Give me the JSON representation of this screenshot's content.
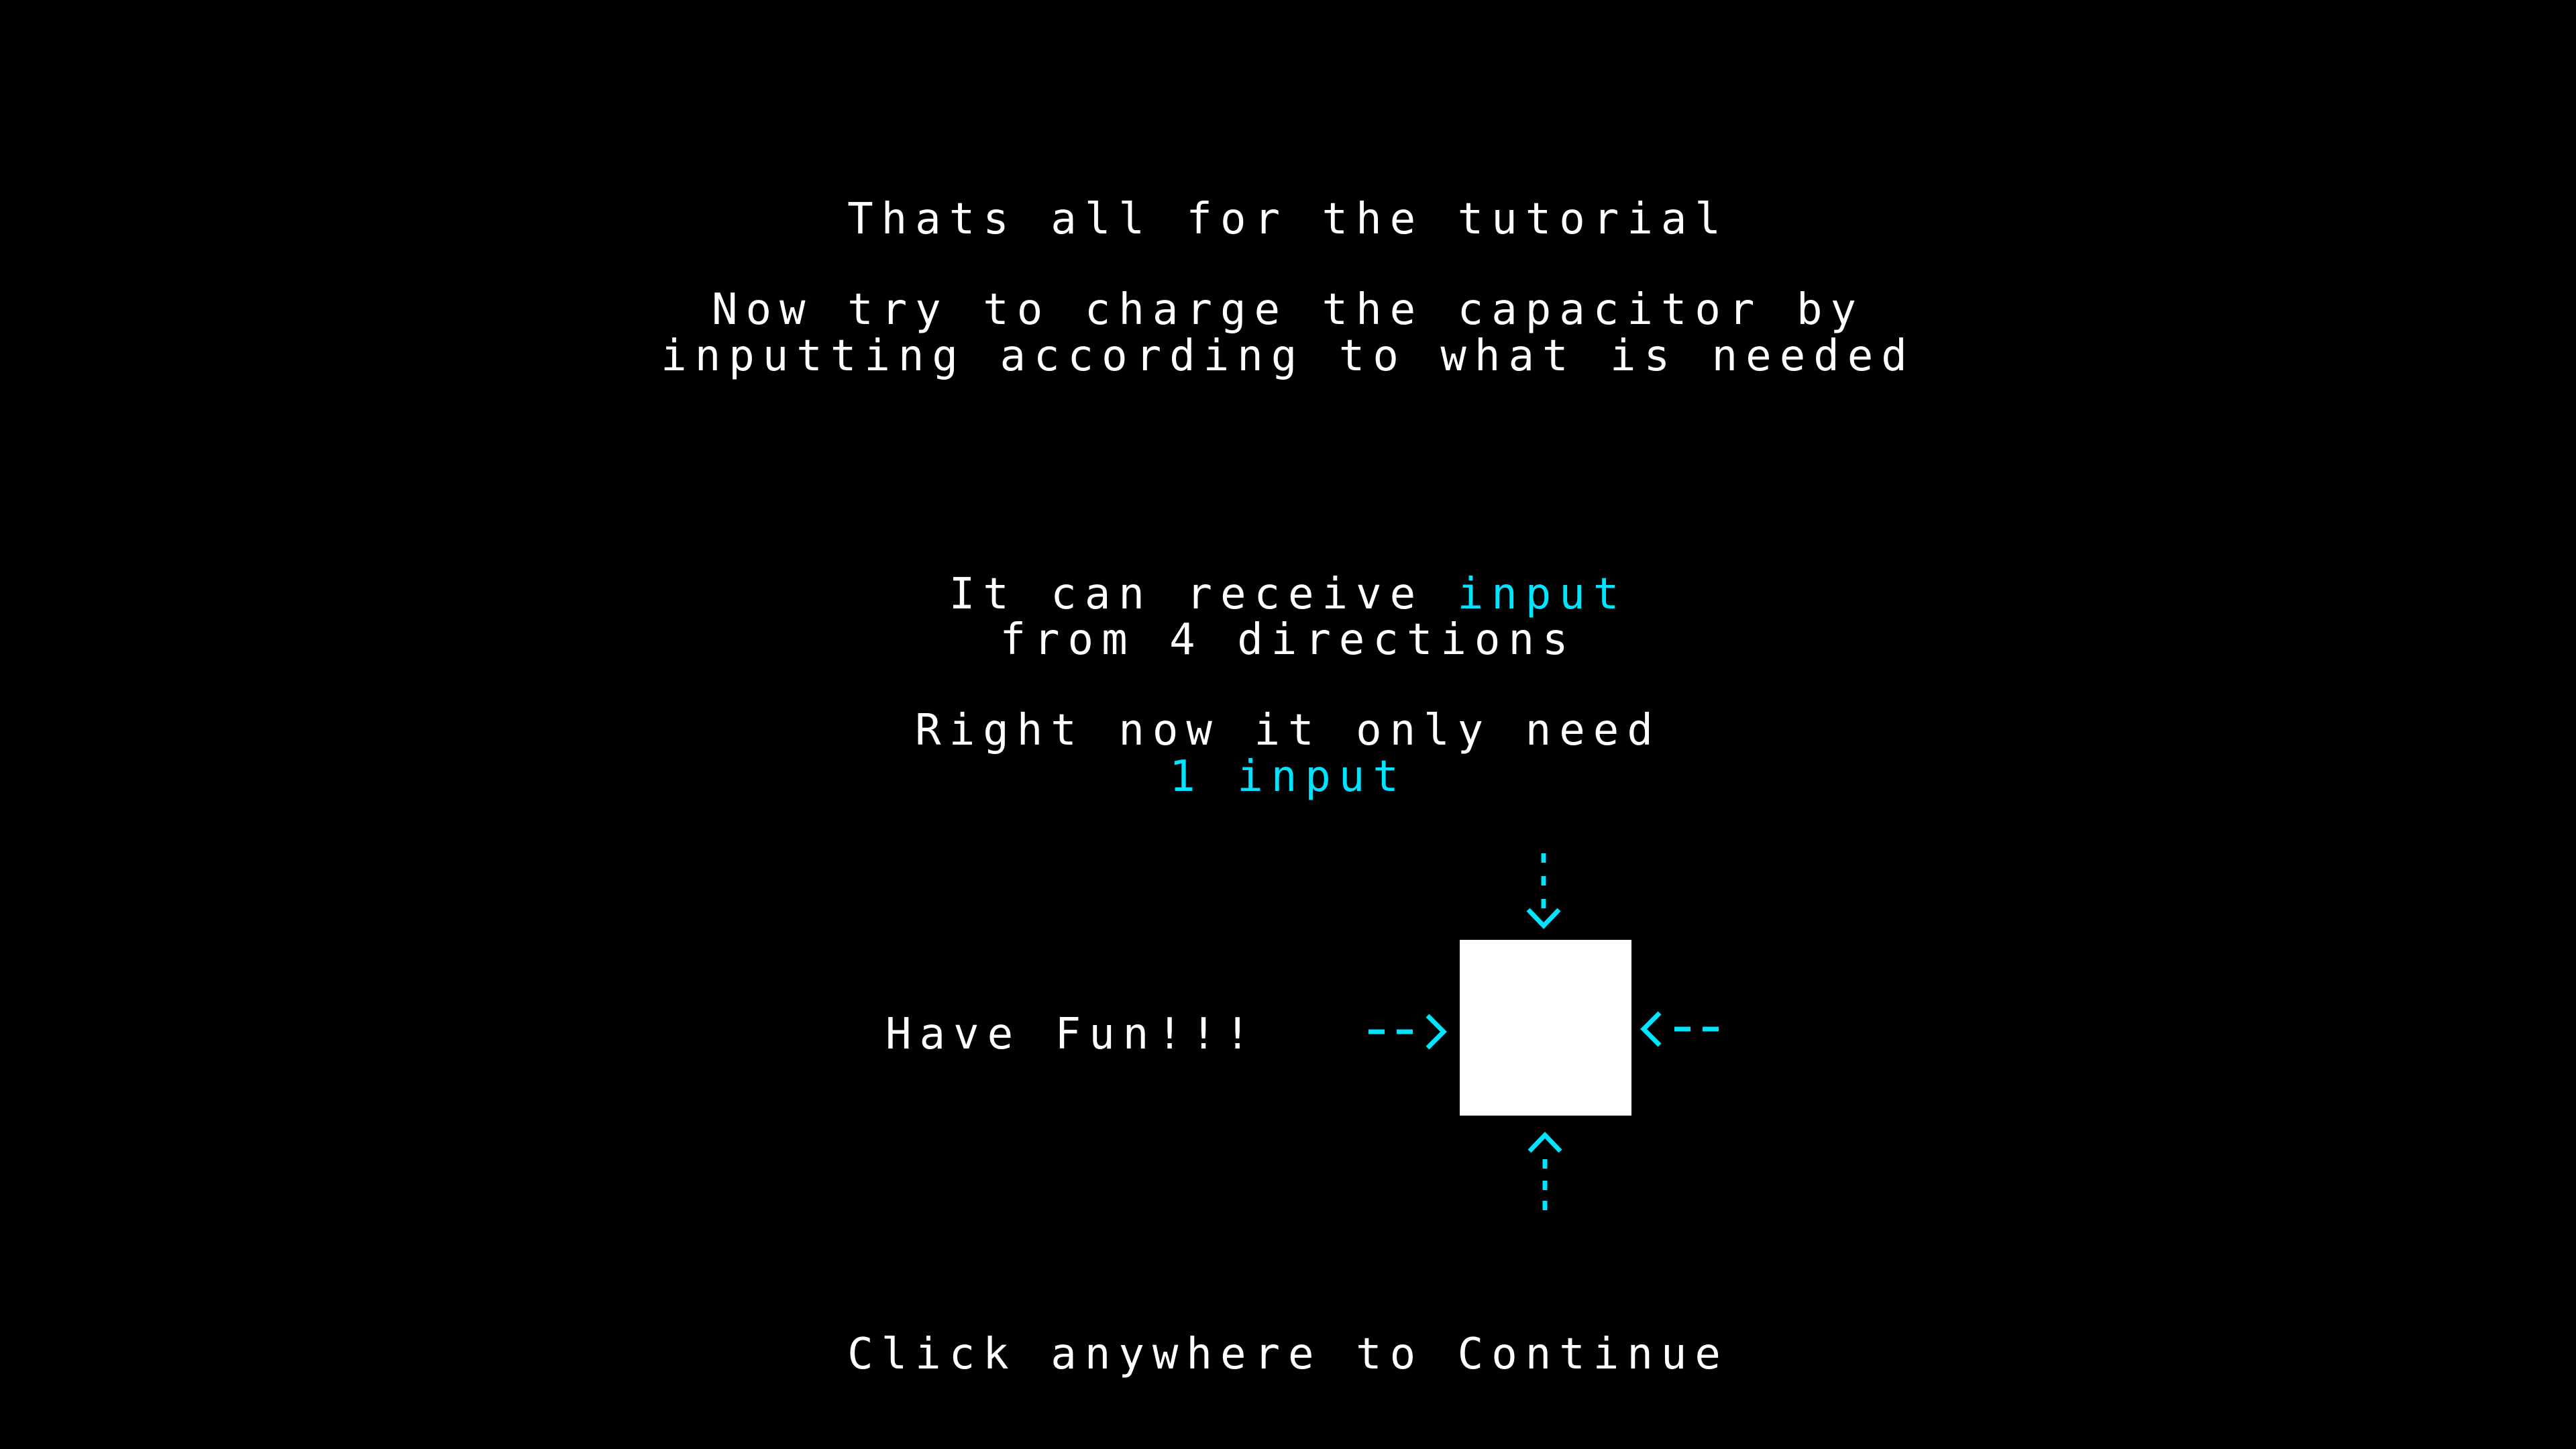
{
  "tutorial": {
    "title": "Thats all for the tutorial",
    "instruction_line1": "Now try to charge the capacitor by",
    "instruction_line2": "inputting according to what is needed",
    "receive_prefix": "It can receive ",
    "receive_accent": "input",
    "directions": "from 4 directions",
    "need_text": "Right now it only need",
    "need_accent": "1 input",
    "have_fun": "Have Fun!!!",
    "continue": "Click anywhere to Continue"
  },
  "colors": {
    "background": "#000000",
    "text": "#ffffff",
    "accent": "#00e5ff",
    "capacitor": "#ffffff"
  },
  "icons": {
    "capacitor": "white-square",
    "arrows": [
      "arrow-down-icon",
      "arrow-up-icon",
      "arrow-right-icon",
      "arrow-left-icon"
    ]
  }
}
